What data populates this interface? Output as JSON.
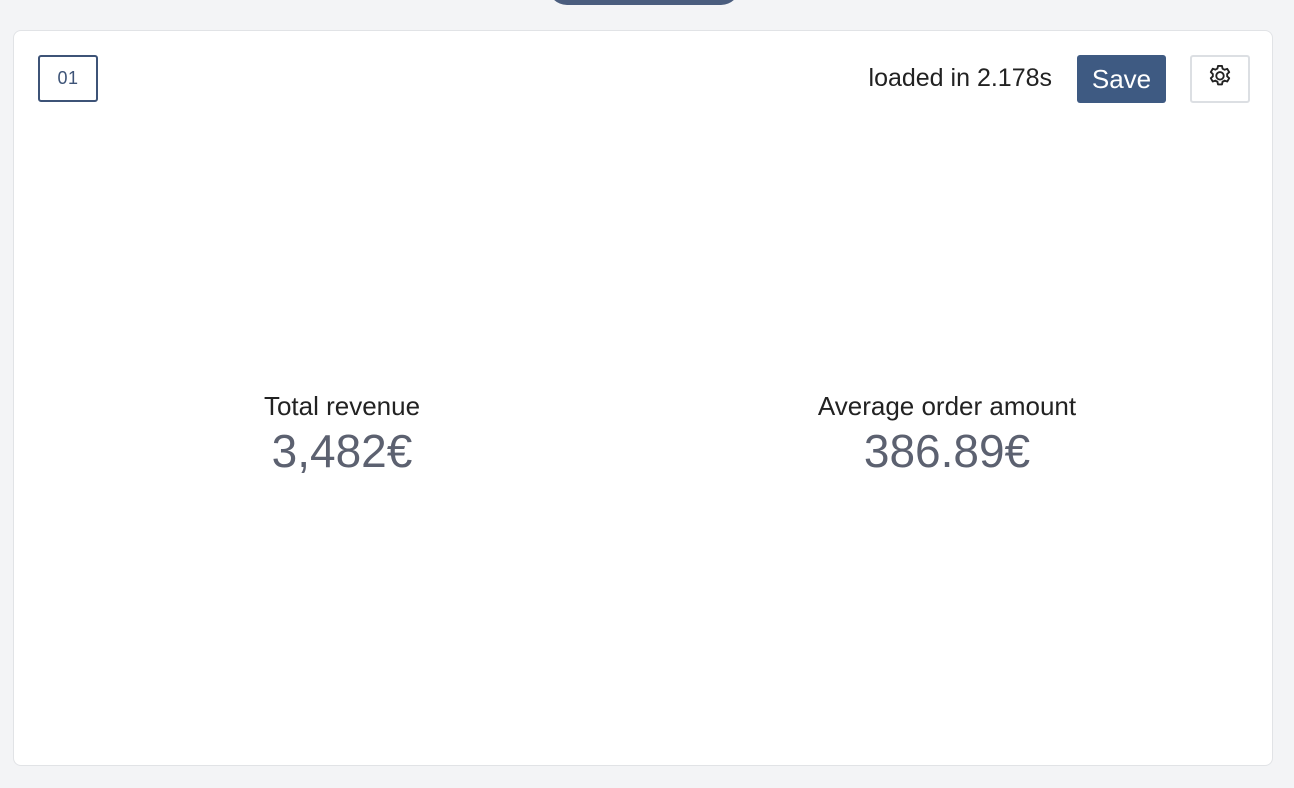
{
  "card": {
    "id_badge": "01",
    "load_status": "loaded in 2.178s",
    "save_label": "Save",
    "settings_icon": "gear-icon"
  },
  "metrics": [
    {
      "label": "Total revenue",
      "value": "3,482€"
    },
    {
      "label": "Average order amount",
      "value": "386.89€"
    }
  ],
  "colors": {
    "accent": "#3e5a82",
    "value_text": "#5c6170",
    "background": "#f3f4f6"
  }
}
